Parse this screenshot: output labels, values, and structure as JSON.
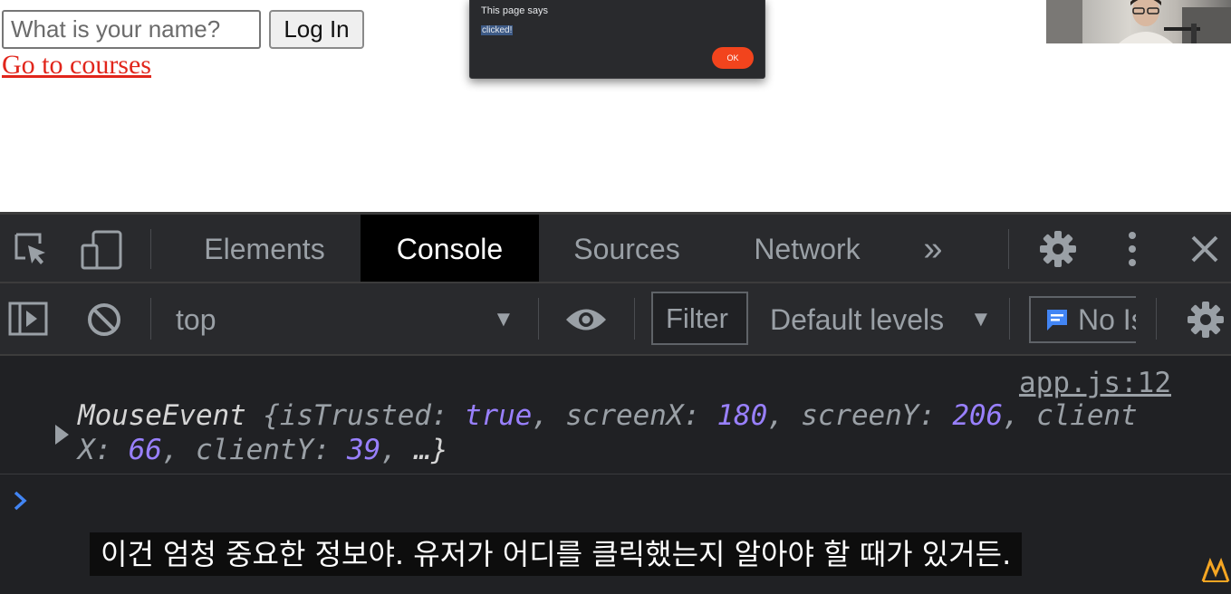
{
  "page": {
    "name_placeholder": "What is your name?",
    "login_label": "Log In",
    "courses_link": "Go to courses"
  },
  "dialog": {
    "title": "This page says",
    "message": "clicked!",
    "ok_label": "OK"
  },
  "devtools": {
    "tabs": [
      {
        "label": "Elements",
        "active": false
      },
      {
        "label": "Console",
        "active": true
      },
      {
        "label": "Sources",
        "active": false
      },
      {
        "label": "Network",
        "active": false
      }
    ],
    "more_tabs": "»",
    "toolbar": {
      "context": "top",
      "filter_placeholder": "Filter",
      "levels": "Default levels",
      "issues": "No Issues"
    },
    "console": {
      "source": "app.js:12",
      "log": {
        "type": "MouseEvent",
        "isTrusted": "true",
        "screenX": "180",
        "screenY": "206",
        "clientX": "66",
        "clientY": "39",
        "ellipsis": "…"
      }
    },
    "colors": {
      "panel_bg": "#202124",
      "toolbar_bg": "#292a2d",
      "active_tab_bg": "#000000",
      "value_purple": "#9980ff",
      "prompt_blue": "#4285f4"
    }
  },
  "subtitle": "이건 엄청 중요한 정보야. 유저가 어디를 클릭했는지 알아야 할 때가 있거든."
}
